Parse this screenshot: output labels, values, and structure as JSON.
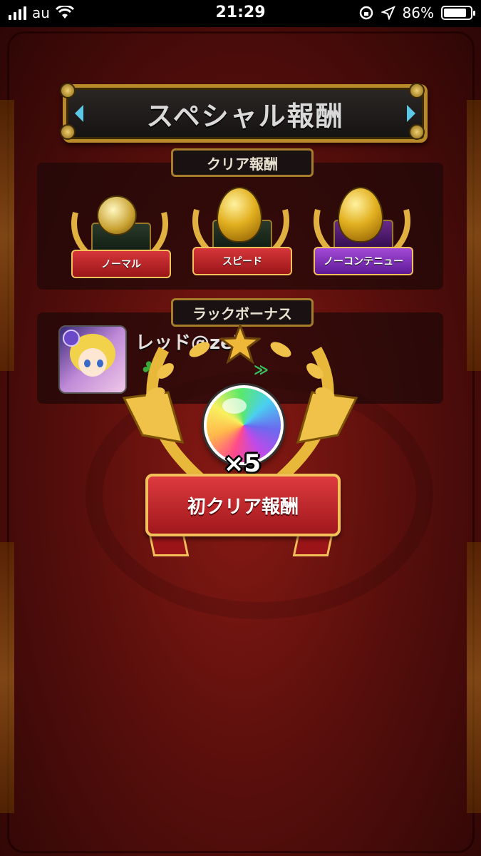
{
  "status_bar": {
    "carrier": "au",
    "time": "21:29",
    "battery": "86%",
    "battery_level": 0.86
  },
  "title": "スペシャル報酬",
  "clear_rewards": {
    "label": "クリア報酬",
    "items": [
      {
        "label": "ノーマル",
        "item": "gem-chest",
        "ribbon_color": "#c3262a"
      },
      {
        "label": "スピード",
        "item": "golden-egg",
        "ribbon_color": "#c3262a"
      },
      {
        "label": "ノーコンテニュー",
        "item": "golden-egg",
        "ribbon_color": "#7a2ab8"
      }
    ]
  },
  "luck_bonus": {
    "label": "ラックボーナス",
    "player_name": "レッド@zek",
    "clover_icon": "clover-icon",
    "chevrons": "≫"
  },
  "first_clear_reward": {
    "multiplier": "×5",
    "banner": "初クリア報酬",
    "item": "rainbow-orb"
  },
  "colors": {
    "background": "#5a0f0c",
    "gold": "#b88a2a",
    "ribbon_red": "#c3262a",
    "ribbon_purple": "#7a2ab8"
  }
}
